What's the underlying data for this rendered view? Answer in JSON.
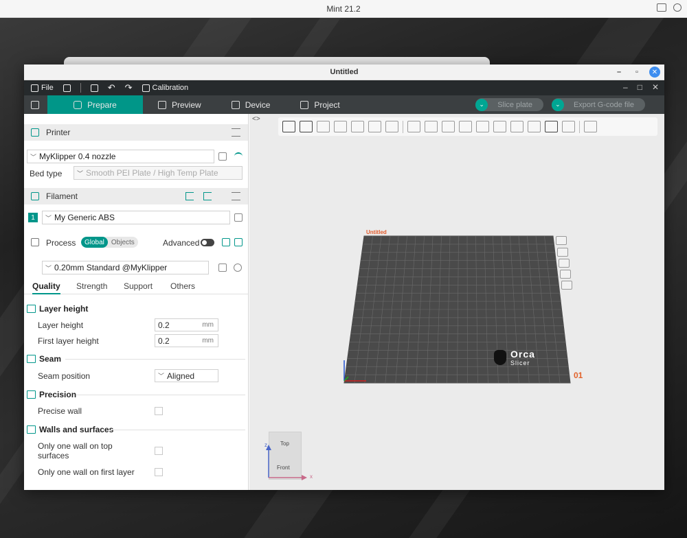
{
  "os": {
    "title": "Mint 21.2"
  },
  "window": {
    "title": "Untitled"
  },
  "menu": {
    "file": "File",
    "calibration": "Calibration"
  },
  "tabs": {
    "prepare": "Prepare",
    "preview": "Preview",
    "device": "Device",
    "project": "Project"
  },
  "actions": {
    "slice": "Slice plate",
    "export": "Export G-code file"
  },
  "printer": {
    "section": "Printer",
    "preset": "MyKlipper 0.4 nozzle",
    "bed_type_label": "Bed type",
    "bed_type_value": "Smooth PEI Plate / High Temp Plate"
  },
  "filament": {
    "section": "Filament",
    "index": "1",
    "preset": "My Generic ABS"
  },
  "process": {
    "section": "Process",
    "global": "Global",
    "objects": "Objects",
    "advanced": "Advanced",
    "preset": "0.20mm Standard @MyKlipper"
  },
  "quality_tabs": {
    "quality": "Quality",
    "strength": "Strength",
    "support": "Support",
    "others": "Others"
  },
  "settings": {
    "layer_height_group": "Layer height",
    "layer_height_label": "Layer height",
    "layer_height_value": "0.2",
    "first_layer_label": "First layer height",
    "first_layer_value": "0.2",
    "unit": "mm",
    "seam_group": "Seam",
    "seam_position_label": "Seam position",
    "seam_position_value": "Aligned",
    "precision_group": "Precision",
    "precise_wall_label": "Precise wall",
    "walls_group": "Walls and surfaces",
    "one_wall_top_label": "Only one wall on top surfaces",
    "one_wall_first_label": "Only one wall on first layer"
  },
  "plate": {
    "name": "Untitled",
    "number": "01",
    "logo_line1": "Orca",
    "logo_line2": "Slicer"
  },
  "nav_cube": {
    "top": "Top",
    "front": "Front",
    "z": "z",
    "x": "x"
  }
}
